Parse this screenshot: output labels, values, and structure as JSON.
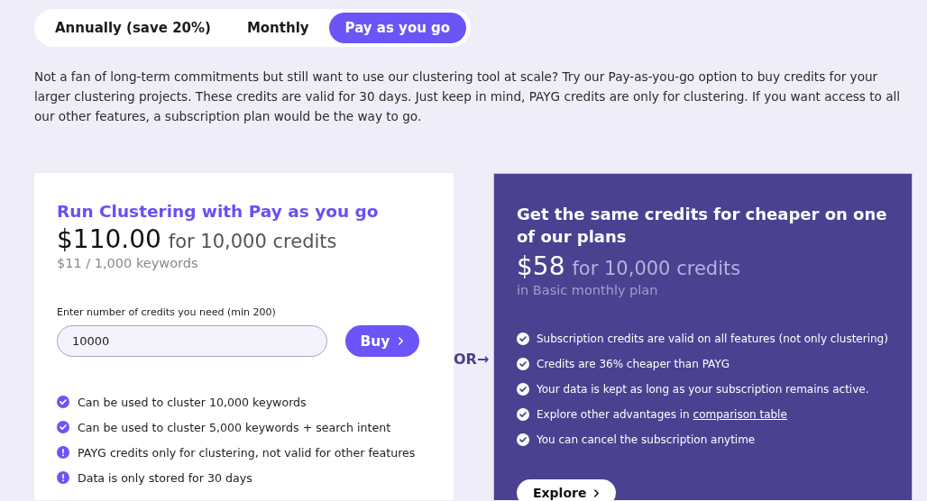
{
  "tabs": [
    {
      "label": "Annually (save 20%)",
      "selected": false
    },
    {
      "label": "Monthly",
      "selected": false
    },
    {
      "label": "Pay as you go",
      "selected": true
    }
  ],
  "intro": "Not a fan of long-term commitments but still want to use our clustering tool at scale? Try our Pay-as-you-go option to buy credits for your larger clustering projects. These credits are valid for 30 days. Just keep in mind, PAYG credits are only for clustering. If you want access to all our other features, a subscription plan would be the way to go.",
  "payg_card": {
    "title": "Run Clustering with Pay as you go",
    "price": "$110.00",
    "price_unit": "for 10,000 credits",
    "rate": "$11 / 1,000 keywords",
    "field_label": "Enter number of credits you need (min 200)",
    "field_value": "10000",
    "button": "Buy",
    "features": [
      {
        "kind": "check",
        "text": "Can be used to cluster 10,000 keywords"
      },
      {
        "kind": "check",
        "text": "Can be used to cluster 5,000 keywords + search intent"
      },
      {
        "kind": "warning",
        "text": "PAYG credits only for clustering, not valid for other features"
      },
      {
        "kind": "warning",
        "text": "Data is only stored for 30 days"
      }
    ]
  },
  "separator": "OR→",
  "plan_card": {
    "title": "Get the same credits for cheaper on one of our plans",
    "price": "$58",
    "price_unit": "for 10,000 credits",
    "note": "in Basic monthly plan",
    "features": [
      {
        "text": "Subscription credits are valid on all features (not only clustering)"
      },
      {
        "text": "Credits are 36% cheaper than PAYG"
      },
      {
        "text": "Your data is kept as long as your subscription remains active."
      },
      {
        "text": "Explore other advantages in ",
        "link": "comparison table"
      },
      {
        "text": "You can cancel the subscription anytime"
      }
    ],
    "button": "Explore"
  }
}
